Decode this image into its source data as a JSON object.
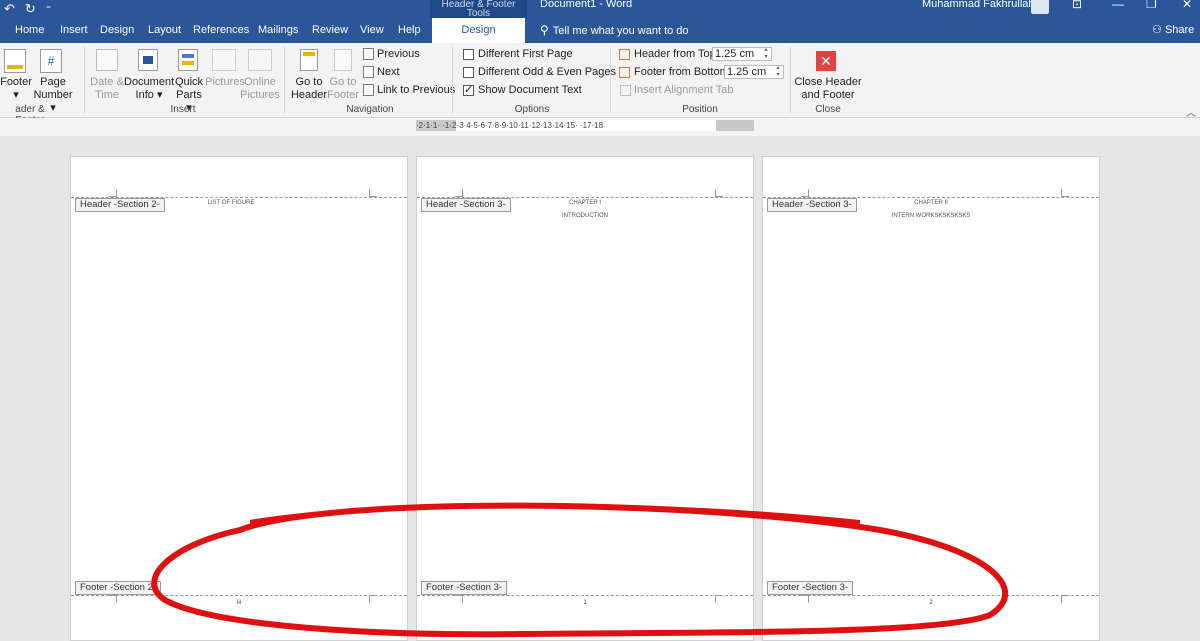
{
  "titlebar": {
    "qat_undo": "↶",
    "qat_redo": "↻",
    "qat_more": "⁼",
    "context_group": "Header & Footer Tools",
    "document_title": "Document1  -  Word",
    "user_name": "Muhammad Fakhrullah",
    "minimize": "—",
    "restore": "❐",
    "close": "✕"
  },
  "tabs": {
    "home": "Home",
    "insert": "Insert",
    "design": "Design",
    "layout": "Layout",
    "references": "References",
    "mailings": "Mailings",
    "review": "Review",
    "view": "View",
    "help": "Help",
    "hf_design": "Design",
    "tell_me": "Tell me what you want to do",
    "share": "Share"
  },
  "ribbon": {
    "footer_label": "Footer",
    "page_number_label_1": "Page",
    "page_number_label_2": "Number",
    "group_header_footer": "ader & Footer",
    "date_time_1": "Date &",
    "date_time_2": "Time",
    "document_info_1": "Document",
    "document_info_2": "Info",
    "quick_parts_1": "Quick",
    "quick_parts_2": "Parts",
    "pictures": "Pictures",
    "online_pictures_1": "Online",
    "online_pictures_2": "Pictures",
    "group_insert": "Insert",
    "goto_header_1": "Go to",
    "goto_header_2": "Header",
    "goto_footer_1": "Go to",
    "goto_footer_2": "Footer",
    "previous": "Previous",
    "next": "Next",
    "link_to_previous": "Link to Previous",
    "group_navigation": "Navigation",
    "different_first_page": "Different First Page",
    "different_odd_even": "Different Odd & Even Pages",
    "show_document_text": "Show Document Text",
    "group_options": "Options",
    "header_from_top_label": "Header from Top:",
    "header_from_top_value": "1.25 cm",
    "footer_from_bottom_label": "Footer from Bottom:",
    "footer_from_bottom_value": "1.25 cm",
    "insert_alignment_tab": "Insert Alignment Tab",
    "group_position": "Position",
    "close_hf_1": "Close Header",
    "close_hf_2": "and Footer",
    "group_close": "Close"
  },
  "ruler": {
    "text": "·2·1·1·  ·1·2·3·4·5·6·7·8·9·10·11·12·13·14·15·  ·17·18"
  },
  "pages": [
    {
      "header_tag": "Header -Section 2-",
      "header_line1": "LIST OF FIGURE",
      "header_line2": "",
      "footer_tag": "Footer -Section 2-",
      "page_number": "iii"
    },
    {
      "header_tag": "Header -Section 3-",
      "header_line1": "CHAPTER I",
      "header_line2": "INTRODUCTION",
      "footer_tag": "Footer -Section 3-",
      "page_number": "1"
    },
    {
      "header_tag": "Header -Section 3-",
      "header_line1": "CHAPTER II",
      "header_line2": "INTERN WORKSKSKSKSKS",
      "footer_tag": "Footer -Section 3-",
      "page_number": "2"
    }
  ],
  "colors": {
    "brand": "#2b579a",
    "annotation": "#e01010",
    "close_button": "#e04343"
  }
}
